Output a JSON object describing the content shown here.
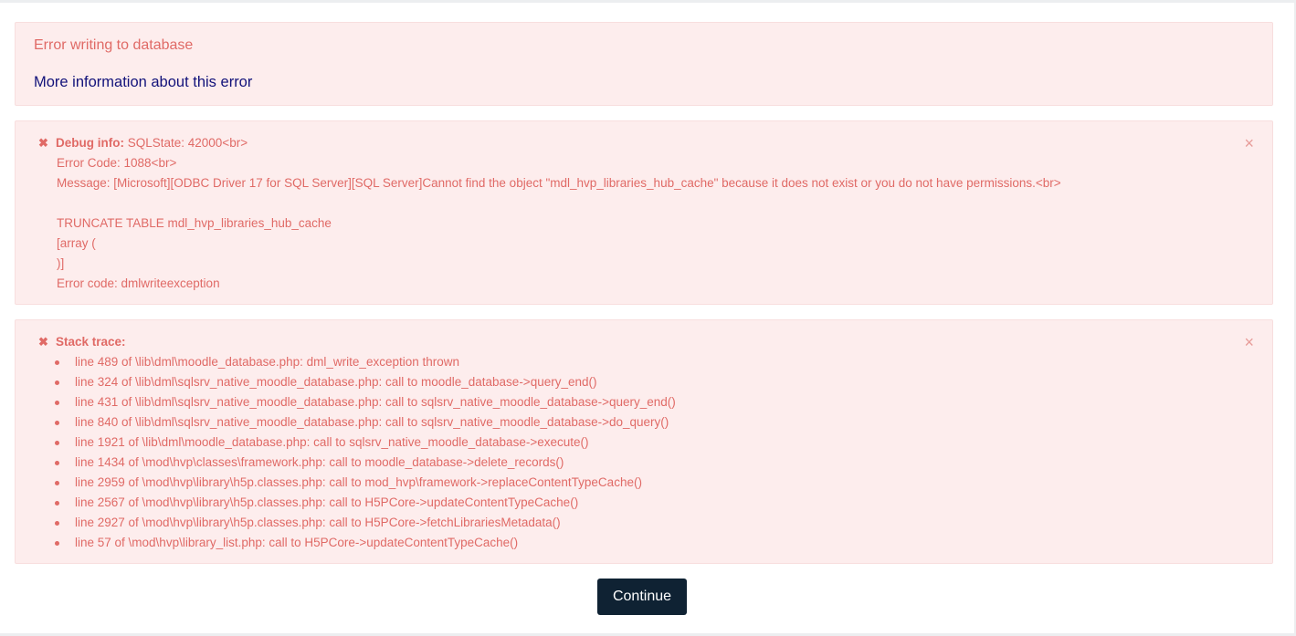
{
  "error": {
    "title": "Error writing to database",
    "more_info_link": "More information about this error"
  },
  "debug": {
    "label": "Debug info:",
    "first_line": " SQLState: 42000<br>",
    "lines": [
      "Error Code: 1088<br>",
      "Message: [Microsoft][ODBC Driver 17 for SQL Server][SQL Server]Cannot find the object \"mdl_hvp_libraries_hub_cache\" because it does not exist or you do not have permissions.<br>",
      "",
      "TRUNCATE TABLE mdl_hvp_libraries_hub_cache",
      "[array (",
      ")]",
      "Error code: dmlwriteexception"
    ],
    "close_glyph": "×",
    "icon_glyph": "✖"
  },
  "stack": {
    "label": "Stack trace:",
    "items": [
      "line 489 of \\lib\\dml\\moodle_database.php: dml_write_exception thrown",
      "line 324 of \\lib\\dml\\sqlsrv_native_moodle_database.php: call to moodle_database->query_end()",
      "line 431 of \\lib\\dml\\sqlsrv_native_moodle_database.php: call to sqlsrv_native_moodle_database->query_end()",
      "line 840 of \\lib\\dml\\sqlsrv_native_moodle_database.php: call to sqlsrv_native_moodle_database->do_query()",
      "line 1921 of \\lib\\dml\\moodle_database.php: call to sqlsrv_native_moodle_database->execute()",
      "line 1434 of \\mod\\hvp\\classes\\framework.php: call to moodle_database->delete_records()",
      "line 2959 of \\mod\\hvp\\library\\h5p.classes.php: call to mod_hvp\\framework->replaceContentTypeCache()",
      "line 2567 of \\mod\\hvp\\library\\h5p.classes.php: call to H5PCore->updateContentTypeCache()",
      "line 2927 of \\mod\\hvp\\library\\h5p.classes.php: call to H5PCore->fetchLibrariesMetadata()",
      "line 57 of \\mod\\hvp\\library_list.php: call to H5PCore->updateContentTypeCache()"
    ],
    "close_glyph": "×",
    "icon_glyph": "✖"
  },
  "actions": {
    "continue_label": "Continue"
  },
  "colors": {
    "alert_bg": "#fdeded",
    "alert_text": "#e06a66",
    "link": "#12127a",
    "button_bg": "#0f2233"
  }
}
